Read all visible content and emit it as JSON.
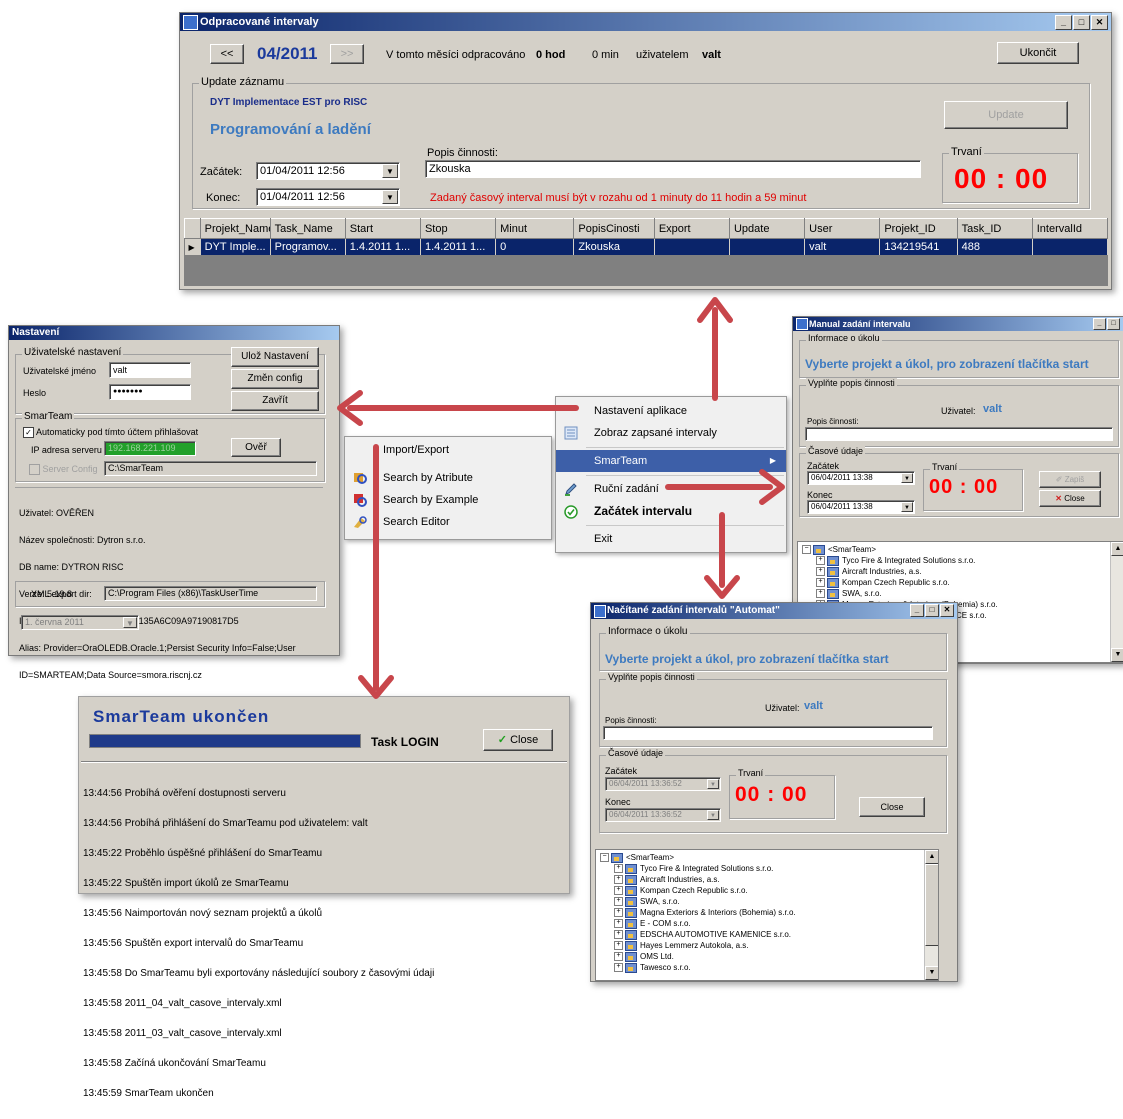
{
  "intervals_window": {
    "title": "Odpracované intervaly",
    "prev_button": "<<",
    "month": "04/2011",
    "next_button": ">>",
    "summary_prefix": "V tomto měsíci odpracováno",
    "hours": "0 hod",
    "minutes": "0 min",
    "user_prefix": "uživatelem",
    "user": "valt",
    "exit_button": "Ukončit",
    "update_group": "Update záznamu",
    "project_name": "DYT Implementace EST pro RISC",
    "task_name": "Programování a ladění",
    "update_button": "Update",
    "popis_label": "Popis činnosti:",
    "popis_value": "Zkouska",
    "start_label": "Začátek:",
    "start_value": "01/04/2011 12:56",
    "end_label": "Konec:",
    "end_value": "01/04/2011 12:56",
    "warning": "Zadaný časový interval musí být v rozahu od 1 minuty do 11 hodin a 59 minut",
    "duration_label": "Trvaní",
    "duration": "00 : 00",
    "columns": [
      "Projekt_Name",
      "Task_Name",
      "Start",
      "Stop",
      "Minut",
      "PopisCinosti",
      "Export",
      "Update",
      "User",
      "Projekt_ID",
      "Task_ID",
      "IntervalId"
    ],
    "row": [
      "DYT Imple...",
      "Programov...",
      "1.4.2011 1...",
      "1.4.2011 1...",
      "0",
      "Zkouska",
      "",
      "",
      "valt",
      "134219541",
      "488",
      ""
    ]
  },
  "settings_window": {
    "title": "Nastavení",
    "user_group": "Uživatelské nastavení",
    "username_label": "Uživatelské jméno",
    "username_value": "valt",
    "password_label": "Heslo",
    "password_value": "●●●●●●●",
    "save_button": "Ulož Nastavení",
    "change_config_button": "Změn config",
    "close_button": "Zavřít",
    "smarteam_group": "SmarTeam",
    "auto_login_label": "Automaticky pod tímto účtem přihlašovat",
    "ip_label": "IP adresa serveru",
    "ip_value": "192.168.221.109",
    "verify_button": "Ověř",
    "server_config_label": "Server Config",
    "server_config_value": "C:\\SmarTeam",
    "info_lines": [
      "Uživatel: OVĚŘEN",
      "Název společnosti: Dytron s.r.o.",
      "DB name: DYTRON RISC",
      "Verze: 5.19.8",
      "Identifikace: F2A91756B08D4135A6C09A97190817D5",
      "Alias: Provider=OraOLEDB.Oracle.1;Persist Security Info=False;User",
      "ID=SMARTEAM;Data Source=smora.riscnj.cz"
    ],
    "xml_label": "XML export dir:",
    "xml_value": "C:\\Program Files (x86)\\TaskUserTime",
    "date_value": "1.  června  2011"
  },
  "context_menu": {
    "items": [
      "Nastavení aplikace",
      "Zobraz zapsané intervaly",
      "SmarTeam",
      "Ruční zadání",
      "Začátek intervalu",
      "Exit"
    ]
  },
  "submenu": {
    "items": [
      "Import/Export",
      "Search by Atribute",
      "Search by Example",
      "Search Editor"
    ]
  },
  "manual_window": {
    "title": "Manual zadání intervalu",
    "info_group": "Informace o úkolu",
    "select_text": "Vyberte projekt a úkol, pro zobrazení tlačítka start",
    "fill_group": "Vyplňte popis činnosti",
    "user_label": "Uživatel:",
    "user_value": "valt",
    "popis_label": "Popis činnosti:",
    "time_group": "Časové údaje",
    "start_label": "Začátek",
    "start_value": "06/04/2011 13:38",
    "end_label": "Konec",
    "end_value": "06/04/2011 13:38",
    "duration_label": "Trvaní",
    "duration": "00 : 00",
    "save_button": "Zapiš",
    "close_button": "Close",
    "tree": [
      "<SmarTeam>",
      "Tyco Fire & Integrated Solutions s.r.o.",
      "Aircraft Industries, a.s.",
      "Kompan Czech Republic s.r.o.",
      "SWA, s.r.o.",
      "Magna Exteriors & Interiors (Bohemia) s.r.o.",
      "NICE s.r.o."
    ]
  },
  "auto_window": {
    "title": "Načítané zadání intervalů \"Automat\"",
    "info_group": "Informace o úkolu",
    "select_text": "Vyberte projekt a úkol, pro zobrazení tlačítka start",
    "fill_group": "Vyplňte popis činnosti",
    "user_label": "Uživatel:",
    "user_value": "valt",
    "popis_label": "Popis činnosti:",
    "time_group": "Časové údaje",
    "start_label": "Začátek",
    "start_value": "06/04/2011 13:36:52",
    "end_label": "Konec",
    "end_value": "06/04/2011 13:36:52",
    "duration_label": "Trvaní",
    "duration": "00 : 00",
    "close_button": "Close",
    "tree": [
      "<SmarTeam>",
      "Tyco Fire & Integrated Solutions s.r.o.",
      "Aircraft Industries, a.s.",
      "Kompan Czech Republic s.r.o.",
      "SWA, s.r.o.",
      "Magna Exteriors & Interiors (Bohemia) s.r.o.",
      "E - COM s.r.o.",
      "EDSCHA AUTOMOTIVE KAMENICE s.r.o.",
      "Hayes Lemmerz Autokola, a.s.",
      "OMS Ltd.",
      "Tawesco s.r.o."
    ]
  },
  "smarteam_window": {
    "title": "SmarTeam ukončen",
    "status": "Task LOGIN",
    "close_button": "Close",
    "log": [
      "13:44:56 Probíhá ověření dostupnosti serveru",
      "13:44:56 Probíhá přihlášení do SmarTeamu pod uživatelem: valt",
      "13:45:22 Proběhlo úspěšné přihlášení do SmarTeamu",
      "13:45:22 Spuštěn import úkolů ze SmarTeamu",
      "13:45:56 Naimportován nový seznam projektů a úkolů",
      "13:45:56 Spuštěn export intervalů do SmarTeamu",
      "13:45:58 Do SmarTeamu byli exportovány následující soubory z časovými údaji",
      "13:45:58 2011_04_valt_casove_intervaly.xml",
      "13:45:58 2011_03_valt_casove_intervaly.xml",
      "13:45:58 Začíná ukončování SmarTeamu",
      "13:45:59 SmarTeam ukončen"
    ]
  },
  "colors": {
    "accent_arrow": "#c8464b",
    "timer": "#ff0000",
    "title_blue": "#0a246a",
    "selection": "#0a246a"
  }
}
